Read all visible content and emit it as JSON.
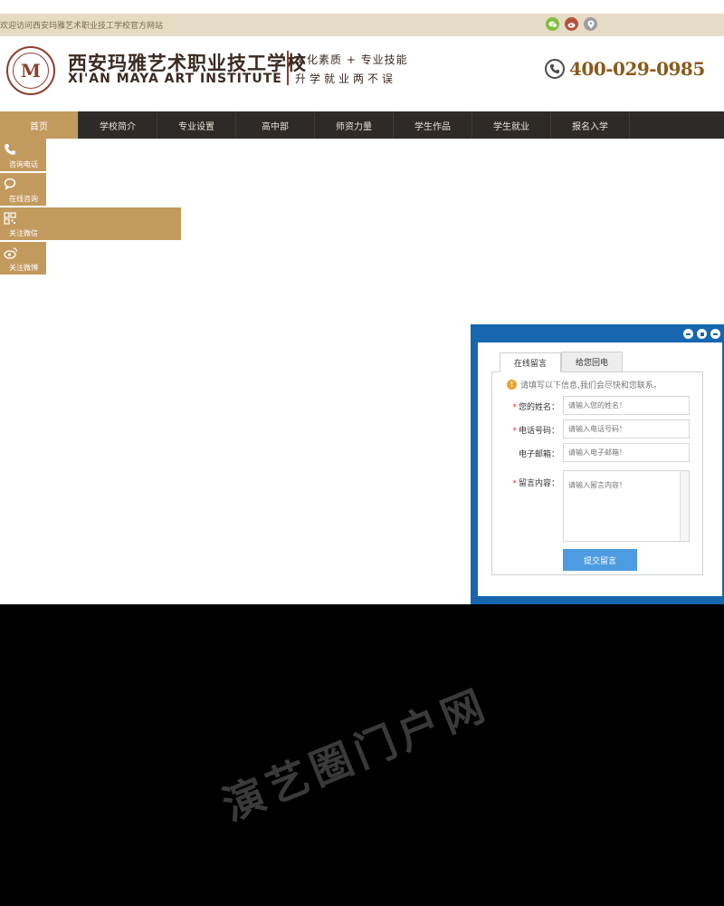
{
  "topbar": {
    "welcome": "欢迎访问西安玛雅艺术职业技工学校官方网站",
    "social_icons": [
      "wechat-icon",
      "weibo-icon",
      "location-icon"
    ]
  },
  "header": {
    "seal_letter": "M",
    "logo_cn": "西安玛雅艺术职业技工学校",
    "logo_en": "XI'AN MAYA ART INSTITUTE",
    "slogan1": "文化素质 + 专业技能",
    "slogan2": "升学就业两不误",
    "phone": "400-029-0985"
  },
  "nav": {
    "items": [
      "首页",
      "学校简介",
      "专业设置",
      "高中部",
      "师资力量",
      "学生作品",
      "学生就业",
      "报名入学"
    ],
    "active_index": 0
  },
  "float_bar": {
    "items": [
      {
        "label": "咨询电话",
        "icon": "phone-icon"
      },
      {
        "label": "在线咨询",
        "icon": "chat-icon"
      },
      {
        "label": "关注微信",
        "icon": "qrcode-icon"
      },
      {
        "label": "关注微博",
        "icon": "weibo-icon"
      }
    ]
  },
  "message_panel": {
    "tabs": [
      "在线留言",
      "给您回电"
    ],
    "notice": "请填写以下信息,我们会尽快和您联系。",
    "fields": [
      {
        "label": "您的姓名：",
        "required": true,
        "placeholder": "请输入您的姓名！"
      },
      {
        "label": "电话号码：",
        "required": true,
        "placeholder": "请输入电话号码！"
      },
      {
        "label": "电子邮箱：",
        "required": false,
        "placeholder": "请输入电子邮箱！"
      }
    ],
    "message_label": "留言内容：",
    "message_placeholder": "请输入留言内容！",
    "submit": "提交留言"
  },
  "watermark": "演艺圈门户网",
  "colors": {
    "brand_gold": "#c29a5e",
    "nav_dark": "#2e2a27",
    "panel_blue": "#1666b0",
    "submit_blue": "#4d9be0",
    "phone_brown": "#8b5a1b"
  }
}
